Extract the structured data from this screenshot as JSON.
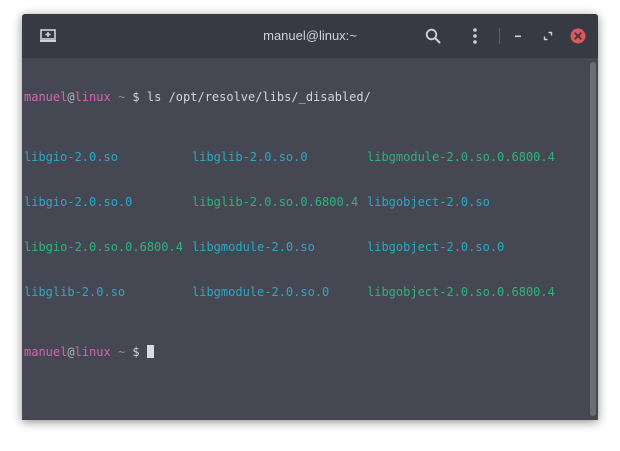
{
  "window": {
    "title": "manuel@linux:~"
  },
  "prompt": {
    "user": "manuel",
    "at": "@",
    "host": "linux",
    "path": "~",
    "symbol": "$"
  },
  "command": "ls /opt/resolve/libs/_disabled/",
  "listing": [
    [
      {
        "name": "libgio-2.0.so",
        "kind": "link"
      },
      {
        "name": "libglib-2.0.so.0",
        "kind": "link"
      },
      {
        "name": "libgmodule-2.0.so.0.6800.4",
        "kind": "exec"
      }
    ],
    [
      {
        "name": "libgio-2.0.so.0",
        "kind": "link"
      },
      {
        "name": "libglib-2.0.so.0.6800.4",
        "kind": "exec"
      },
      {
        "name": "libgobject-2.0.so",
        "kind": "link"
      }
    ],
    [
      {
        "name": "libgio-2.0.so.0.6800.4",
        "kind": "exec"
      },
      {
        "name": "libgmodule-2.0.so",
        "kind": "link"
      },
      {
        "name": "libgobject-2.0.so.0",
        "kind": "link"
      }
    ],
    [
      {
        "name": "libglib-2.0.so",
        "kind": "link"
      },
      {
        "name": "libgmodule-2.0.so.0",
        "kind": "link"
      },
      {
        "name": "libgobject-2.0.so.0.6800.4",
        "kind": "exec"
      }
    ]
  ],
  "icons": {
    "new_tab": "new-tab-icon",
    "search": "search-icon",
    "menu": "kebab-menu-icon",
    "minimize": "minimize-icon",
    "maximize": "maximize-icon",
    "close": "close-icon"
  },
  "colors": {
    "link": "#2aa9c4",
    "exec": "#2fb37b",
    "prompt_user": "#d565b4",
    "close": "#e0575c"
  }
}
